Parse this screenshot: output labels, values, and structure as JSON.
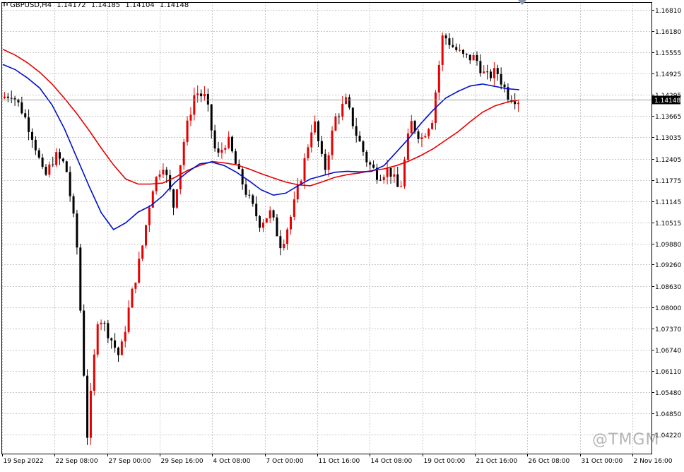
{
  "header": {
    "symbol": "GBPUSD,H4",
    "open": "1.14172",
    "high": "1.14185",
    "low": "1.14104",
    "close": "1.14148"
  },
  "watermark": "@TMGM",
  "colors": {
    "bull": "#e60000",
    "bear": "#000000",
    "ma_red": "#e60000",
    "ma_blue": "#0010c8",
    "grid": "#c8c8c8",
    "price_tag_bg": "#000000",
    "price_tag_fg": "#ffffff"
  },
  "chart_data": {
    "type": "candlestick",
    "instrument": "GBPUSD",
    "timeframe": "H4",
    "ylim": [
      1.0365,
      1.1705
    ],
    "y_ticks": [
      "1.16810",
      "1.16180",
      "1.15555",
      "1.14925",
      "1.14295",
      "1.13665",
      "1.13035",
      "1.12405",
      "1.11775",
      "1.11145",
      "1.10515",
      "1.09880",
      "1.09260",
      "1.08630",
      "1.08000",
      "1.07370",
      "1.06740",
      "1.06110",
      "1.05480",
      "1.04850",
      "1.04220"
    ],
    "x_labels": [
      "19 Sep 2022",
      "22 Sep 08:00",
      "27 Sep 00:00",
      "29 Sep 16:00",
      "4 Oct 08:00",
      "7 Oct 00:00",
      "11 Oct 16:00",
      "14 Oct 08:00",
      "19 Oct 00:00",
      "21 Oct 16:00",
      "26 Oct 08:00",
      "31 Oct 00:00",
      "2 Nov 16:00"
    ],
    "current_price": "1.14148",
    "series": [
      {
        "name": "",
        "values": [
          1.1565,
          1.1548,
          1.1525,
          1.1497,
          1.1462,
          1.142,
          1.1375,
          1.1325,
          1.1272,
          1.1222,
          1.118,
          1.1165,
          1.1165,
          1.1168,
          1.1185,
          1.1205,
          1.122,
          1.1232,
          1.1228,
          1.1222,
          1.121,
          1.1196,
          1.1183,
          1.1171,
          1.1163,
          1.116,
          1.1172,
          1.1185,
          1.1193,
          1.1198,
          1.1205,
          1.121,
          1.122,
          1.1233,
          1.125,
          1.127,
          1.1295,
          1.132,
          1.135,
          1.1378,
          1.1397,
          1.1408,
          1.1415
        ]
      },
      {
        "name": "",
        "values": [
          1.152,
          1.1505,
          1.148,
          1.145,
          1.14,
          1.133,
          1.1245,
          1.116,
          1.108,
          1.103,
          1.105,
          1.1082,
          1.11,
          1.113,
          1.117,
          1.12,
          1.1225,
          1.123,
          1.122,
          1.12,
          1.1175,
          1.1148,
          1.1132,
          1.1138,
          1.116,
          1.118,
          1.119,
          1.12,
          1.1203,
          1.1201,
          1.1203,
          1.122,
          1.126,
          1.13,
          1.1345,
          1.1385,
          1.142,
          1.144,
          1.1456,
          1.1462,
          1.1455,
          1.1448,
          1.1445
        ]
      }
    ]
  }
}
